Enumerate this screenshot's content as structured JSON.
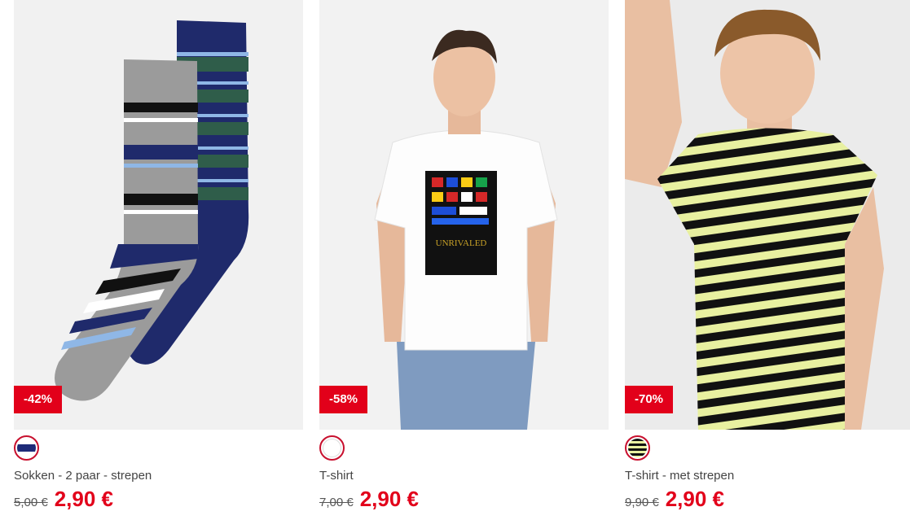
{
  "products": [
    {
      "discount": "-42%",
      "title": "Sokken - 2 paar - strepen",
      "old_price": "5,00 €",
      "new_price": "2,90 €",
      "swatch_colors": [
        "#1e2a78",
        "#ffffff"
      ]
    },
    {
      "discount": "-58%",
      "title": "T-shirt",
      "old_price": "7,00 €",
      "new_price": "2,90 €",
      "swatch_colors": [
        "#ffffff"
      ]
    },
    {
      "discount": "-70%",
      "title": "T-shirt - met strepen",
      "old_price": "9,90 €",
      "new_price": "2,90 €",
      "swatch_colors": [
        "#111111",
        "#e8f0a0"
      ]
    }
  ],
  "colors": {
    "sale_red": "#e2001a",
    "swatch_border": "#c8102e"
  },
  "print_text": "UNRIVALED"
}
